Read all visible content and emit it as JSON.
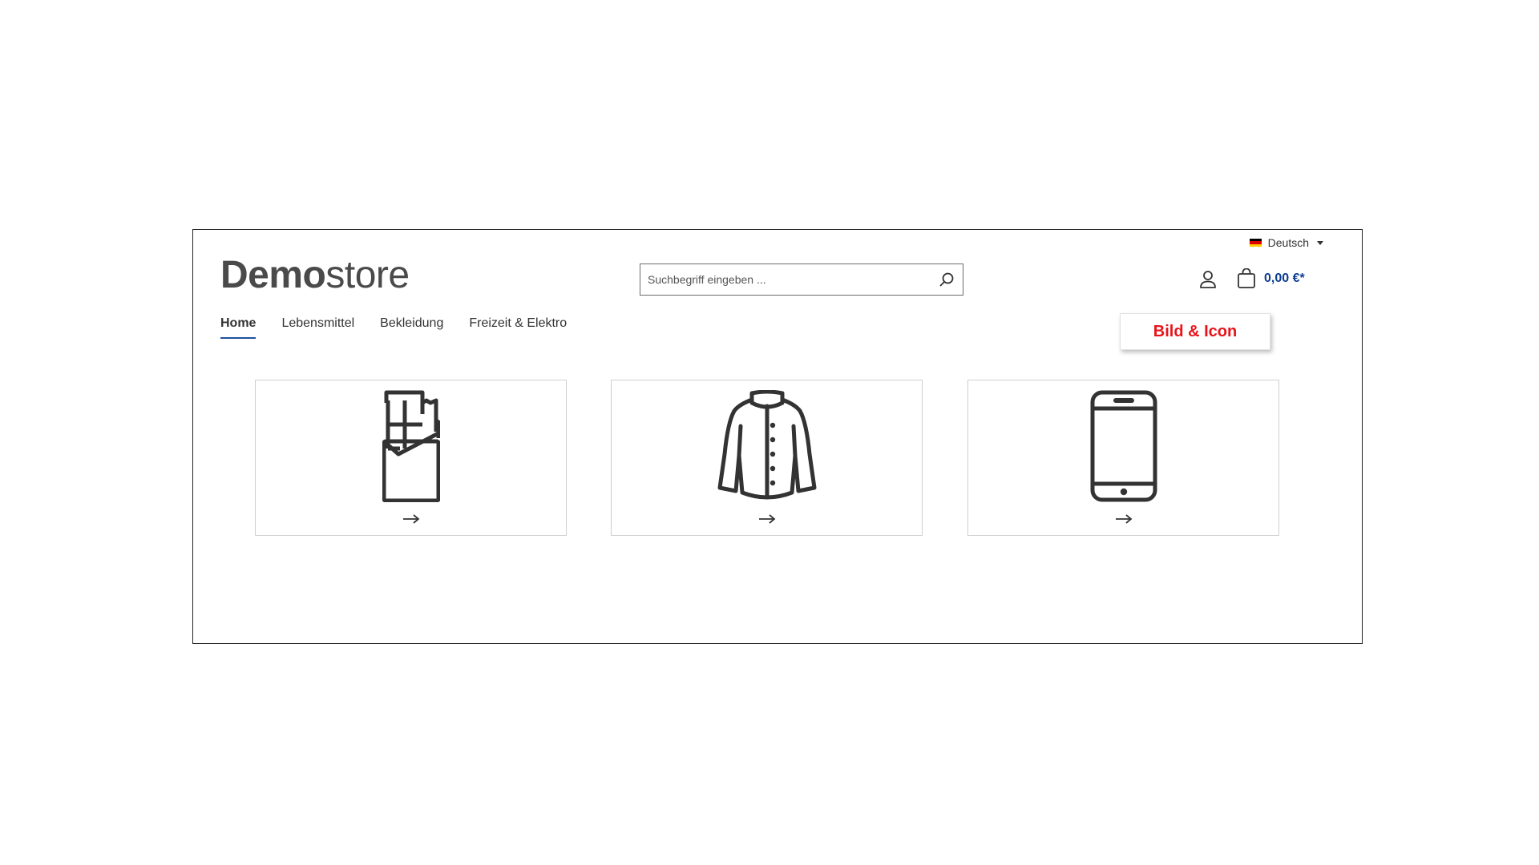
{
  "header": {
    "language": {
      "label": "Deutsch",
      "flag_colors": [
        "#000000",
        "#dd0000",
        "#ffce00"
      ]
    },
    "logo": {
      "bold": "Demo",
      "light": "store"
    },
    "search": {
      "placeholder": "Suchbegriff eingeben ..."
    },
    "cart": {
      "total": "0,00 €*"
    }
  },
  "nav": {
    "items": [
      {
        "label": "Home",
        "active": true
      },
      {
        "label": "Lebensmittel",
        "active": false
      },
      {
        "label": "Bekleidung",
        "active": false
      },
      {
        "label": "Freizeit & Elektro",
        "active": false
      }
    ]
  },
  "badge": {
    "label": "Bild & Icon",
    "color": "#e8141c"
  },
  "cards": [
    {
      "icon": "chocolate-bar-icon"
    },
    {
      "icon": "jacket-icon"
    },
    {
      "icon": "smartphone-icon"
    }
  ],
  "colors": {
    "accent": "#0b3d91",
    "active_underline": "#1f4fa3",
    "icon": "#333333"
  }
}
